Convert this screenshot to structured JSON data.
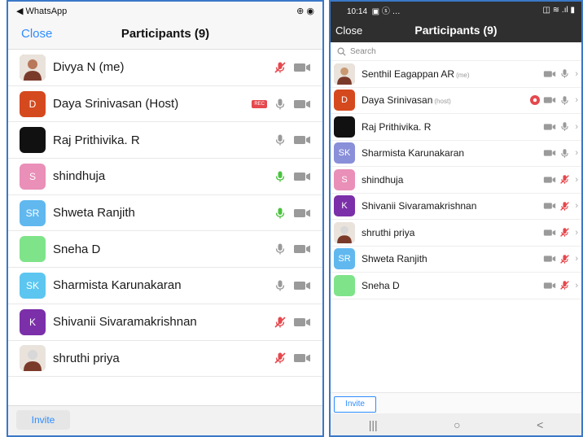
{
  "left": {
    "status": {
      "carrier": "◀ WhatsApp",
      "right": "⊕ ◉"
    },
    "header": {
      "close": "Close",
      "title": "Participants (9)"
    },
    "participants": [
      {
        "name": "Divya N (me)",
        "avatar_type": "photo",
        "avatar_color": "#b8785a",
        "mic": "muted",
        "rec": false
      },
      {
        "name": "Daya Srinivasan (Host)",
        "avatar_type": "initial",
        "initials": "D",
        "avatar_color": "#d5491e",
        "mic": "on",
        "rec": true
      },
      {
        "name": "Raj Prithivika. R",
        "avatar_type": "solid",
        "avatar_color": "#111111",
        "mic": "on",
        "rec": false
      },
      {
        "name": "shindhuja",
        "avatar_type": "initial",
        "initials": "S",
        "avatar_color": "#e98fb8",
        "mic": "active",
        "rec": false
      },
      {
        "name": "Shweta Ranjith",
        "avatar_type": "initial",
        "initials": "SR",
        "avatar_color": "#60b8ef",
        "mic": "active",
        "rec": false
      },
      {
        "name": "Sneha D",
        "avatar_type": "solid",
        "avatar_color": "#7fe38a",
        "mic": "on",
        "rec": false
      },
      {
        "name": "Sharmista Karunakaran",
        "avatar_type": "initial",
        "initials": "SK",
        "avatar_color": "#5cc6f0",
        "mic": "on",
        "rec": false
      },
      {
        "name": "Shivanii Sivaramakrishnan",
        "avatar_type": "initial",
        "initials": "K",
        "avatar_color": "#7b2fa8",
        "mic": "muted",
        "rec": false
      },
      {
        "name": "shruthi priya",
        "avatar_type": "photo",
        "avatar_color": "#d8d8d8",
        "mic": "muted",
        "rec": false
      }
    ],
    "rec_label": "REC",
    "invite": "Invite"
  },
  "right": {
    "status": {
      "time": "10:14",
      "icons": "▣ ⓢ …",
      "right": "◫ ≋ .ıl ▮"
    },
    "header": {
      "close": "Close",
      "title": "Participants (9)"
    },
    "search_placeholder": "Search",
    "participants": [
      {
        "name": "Senthil Eagappan AR",
        "tag": "(me)",
        "avatar_type": "photo",
        "avatar_color": "#c99a72",
        "mic": "on",
        "rec": false,
        "video": "on"
      },
      {
        "name": "Daya Srinivasan",
        "tag": "(host)",
        "avatar_type": "initial",
        "initials": "D",
        "avatar_color": "#d5491e",
        "mic": "on",
        "rec": true,
        "video": "on"
      },
      {
        "name": "Raj Prithivika. R",
        "tag": "",
        "avatar_type": "solid",
        "avatar_color": "#111111",
        "mic": "on",
        "rec": false,
        "video": "on"
      },
      {
        "name": "Sharmista Karunakaran",
        "tag": "",
        "avatar_type": "initial",
        "initials": "SK",
        "avatar_color": "#8a8fd9",
        "mic": "on",
        "rec": false,
        "video": "on"
      },
      {
        "name": "shindhuja",
        "tag": "",
        "avatar_type": "initial",
        "initials": "S",
        "avatar_color": "#e98fb8",
        "mic": "muted",
        "rec": false,
        "video": "on"
      },
      {
        "name": "Shivanii Sivaramakrishnan",
        "tag": "",
        "avatar_type": "initial",
        "initials": "K",
        "avatar_color": "#7b2fa8",
        "mic": "muted",
        "rec": false,
        "video": "on"
      },
      {
        "name": "shruthi priya",
        "tag": "",
        "avatar_type": "photo",
        "avatar_color": "#d8d8d8",
        "mic": "muted",
        "rec": false,
        "video": "on"
      },
      {
        "name": "Shweta Ranjith",
        "tag": "",
        "avatar_type": "initial",
        "initials": "SR",
        "avatar_color": "#60b8ef",
        "mic": "muted",
        "rec": false,
        "video": "on"
      },
      {
        "name": "Sneha D",
        "tag": "",
        "avatar_type": "solid",
        "avatar_color": "#7fe38a",
        "mic": "muted",
        "rec": false,
        "video": "on"
      }
    ],
    "invite": "Invite",
    "nav": {
      "recents": "|||",
      "home": "○",
      "back": "<"
    }
  },
  "colors": {
    "accent": "#2d8cff",
    "muted": "#e5484d",
    "active_mic": "#4bc23f",
    "icon_grey": "#9a9a9a",
    "rec": "#e5484d"
  }
}
